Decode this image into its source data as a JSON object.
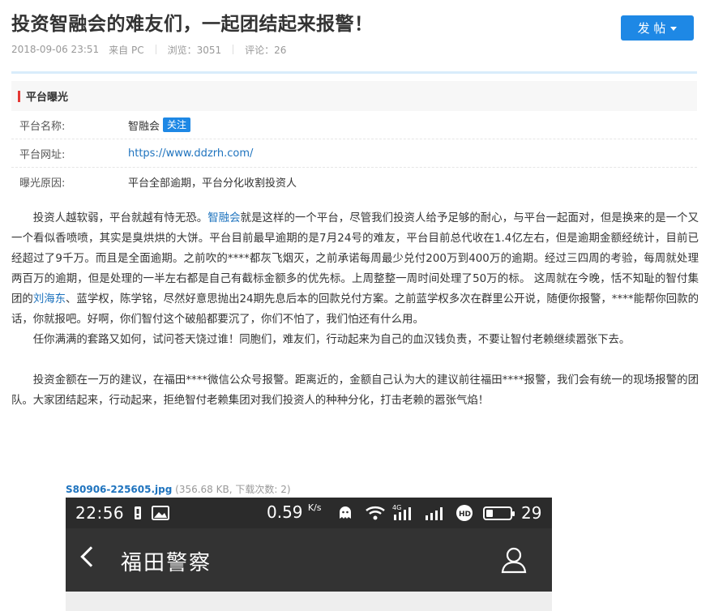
{
  "post": {
    "title": "投资智融会的难友们，一起团结起来报警！",
    "post_button": "发 帖",
    "date": "2018-09-06 23:51",
    "source": "来自 PC",
    "views": "浏览：3051",
    "comments": "评论：26"
  },
  "platform": {
    "heading": "平台曝光",
    "rows": [
      {
        "key": "平台名称:",
        "value": "智融会",
        "badge": "关注"
      },
      {
        "key": "平台网址:",
        "value": "https://www.ddzrh.com/"
      },
      {
        "key": "曝光原因:",
        "value": "平台全部逾期，平台分化收割投资人"
      }
    ]
  },
  "article": {
    "p1_a": "投资人越软弱，平台就越有恃无恐。",
    "p1_link": "智融会",
    "p1_b": "就是这样的一个平台，尽管我们投资人给予足够的耐心，与平台一起面对，但是换来的是一个又一个看似香喷喷，其实是臭烘烘的大饼。平台目前最早逾期的是7月24号的难友，平台目前总代收在1.4亿左右，但是逾期金额经统计，目前已经超过了9千万。而且是全面逾期。之前吹的****都灰飞烟灭，之前承诺每周最少兑付200万到400万的逾期。经过三四周的考验，每周就处理两百万的逾期，但是处理的一半左右都是自己有截标金额多的优先标。上周整整一周时间处理了50万的标。      这周就在今晚，恬不知耻的智付集团的",
    "p1_link2": "刘海东",
    "p1_c": "、蓝学权，陈学铭，尽然好意思抛出24期先息后本的回款兑付方案。之前蓝学权多次在群里公开说，随便你报警，****能帮你回款的话，你就报吧。好啊，你们智付这个破船都要沉了，你们不怕了，我们怕还有什么用。",
    "p2": "任你满满的套路又如何，试问苍天饶过谁！同胞们，难友们，行动起来为自己的血汉钱负责，不要让智付老赖继续嚣张下去。",
    "p3": "投资金额在一万的建议，在福田****微信公众号报警。距离近的，金额自己认为大的建议前往福田****报警，我们会有统一的现场报警的团队。大家团结起来，行动起来，拒绝智付老赖集团对我们投资人的种种分化，打击老赖的嚣张气焰！"
  },
  "attachment": {
    "filename": "S80906-225605.jpg",
    "info": " (356.68 KB, 下载次数: 2)"
  },
  "phone": {
    "time": "22:56",
    "speed": "0.59",
    "speed_unit": "K/s",
    "net_label": "4G",
    "hd_label": "HD",
    "battery_pct": "29",
    "battery_level": 0.29,
    "title": "福田警察"
  },
  "colors": {
    "accent": "#1e88e5",
    "link": "#1e73be",
    "marker": "#e53935",
    "phone_bar": "#333333"
  }
}
